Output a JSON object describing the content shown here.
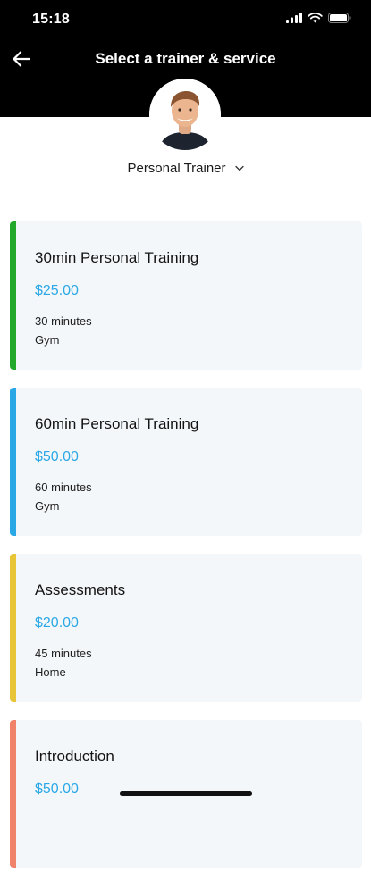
{
  "status_bar": {
    "time": "15:18"
  },
  "nav": {
    "title": "Select a trainer & service",
    "back_icon": "arrow-left-icon"
  },
  "trainer": {
    "name": "Personal Trainer",
    "dropdown_icon": "chevron-down-icon"
  },
  "services": [
    {
      "title": "30min Personal Training",
      "price": "$25.00",
      "duration": "30 minutes",
      "location": "Gym",
      "accent_color": "#22a82b"
    },
    {
      "title": "60min Personal Training",
      "price": "$50.00",
      "duration": "60 minutes",
      "location": "Gym",
      "accent_color": "#2aa8e6"
    },
    {
      "title": "Assessments",
      "price": "$20.00",
      "duration": "45 minutes",
      "location": "Home",
      "accent_color": "#e8c437"
    },
    {
      "title": "Introduction",
      "price": "$50.00",
      "duration": "",
      "location": "",
      "accent_color": "#f0826a"
    }
  ],
  "colors": {
    "header_bg": "#000000",
    "price": "#2aa8e6",
    "card_bg": "#f4f7fa"
  }
}
